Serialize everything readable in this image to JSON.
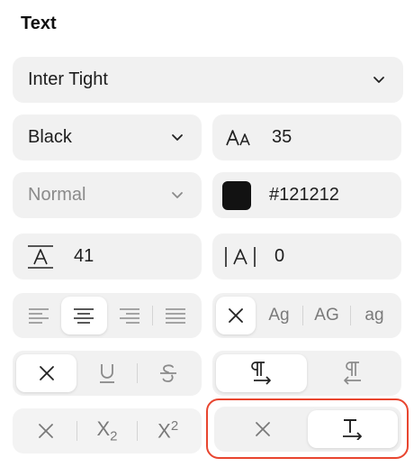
{
  "section_title": "Text",
  "font_family": {
    "value": "Inter Tight"
  },
  "font_weight": {
    "value": "Black"
  },
  "font_size": {
    "value": "35"
  },
  "font_style": {
    "value": "Normal"
  },
  "color": {
    "value": "#121212",
    "swatch": "#121212"
  },
  "line_height": {
    "value": "41"
  },
  "letter_spacing": {
    "value": "0"
  },
  "text_align": {
    "options": [
      "align-left",
      "align-center",
      "align-right",
      "align-justify"
    ],
    "selected": "align-center"
  },
  "text_case": {
    "options": [
      "none",
      "Ag",
      "AG",
      "ag"
    ],
    "labels": {
      "title": "Ag",
      "upper": "AG",
      "lower": "ag"
    },
    "selected": "none"
  },
  "decoration": {
    "options": [
      "none",
      "underline",
      "strikethrough"
    ],
    "selected": "none"
  },
  "direction": {
    "options": [
      "ltr",
      "rtl"
    ],
    "selected": "ltr"
  },
  "script": {
    "options": [
      "none",
      "subscript",
      "superscript"
    ],
    "selected": "none",
    "sub_label": "X",
    "sub_digit": "2",
    "sup_label": "X",
    "sup_digit": "2"
  },
  "text_flow": {
    "options": [
      "none",
      "text-flow"
    ],
    "selected": "text-flow"
  },
  "colors": {
    "highlight": "#e8452f",
    "active_bg": "#ffffff",
    "field_bg": "#f1f1f1"
  }
}
